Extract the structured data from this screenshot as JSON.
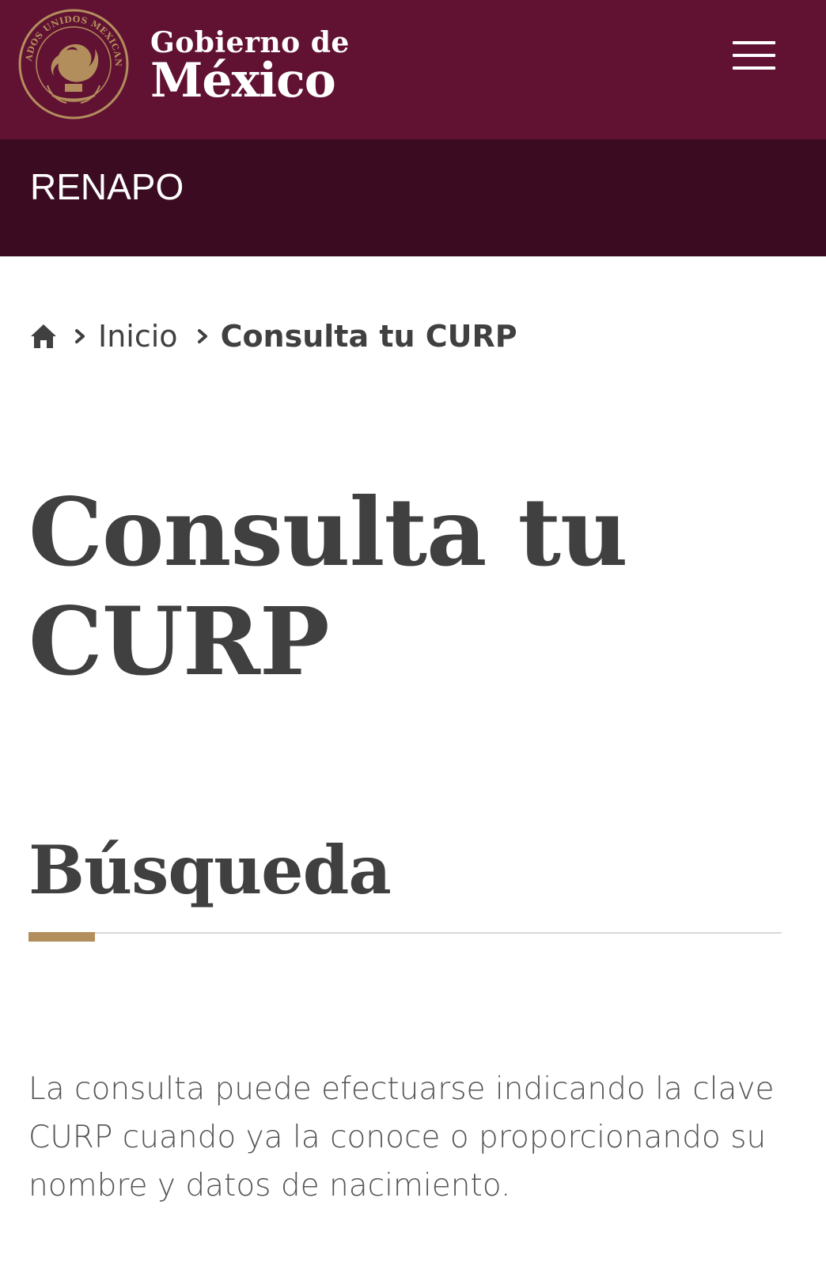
{
  "header": {
    "brand_line1": "Gobierno de",
    "brand_line2": "México",
    "seal_text": "ESTADOS UNIDOS MEXICANOS",
    "seal_icon": "mexican-coat-of-arms-seal",
    "menu_icon": "hamburger-menu-icon",
    "colors": {
      "primary": "#611232",
      "secondary": "#3b0b21",
      "gold": "#b38e5d"
    }
  },
  "subheader": {
    "title": "RENAPO"
  },
  "breadcrumb": {
    "home_icon": "home-icon",
    "items": [
      "Inicio",
      "Consulta tu CURP"
    ]
  },
  "main": {
    "title": "Consulta tu CURP",
    "section_title": "Búsqueda",
    "description": "La consulta puede efectuarse indicando la clave CURP cuando ya la conoce o proporcionando su nombre y datos de nacimiento."
  }
}
